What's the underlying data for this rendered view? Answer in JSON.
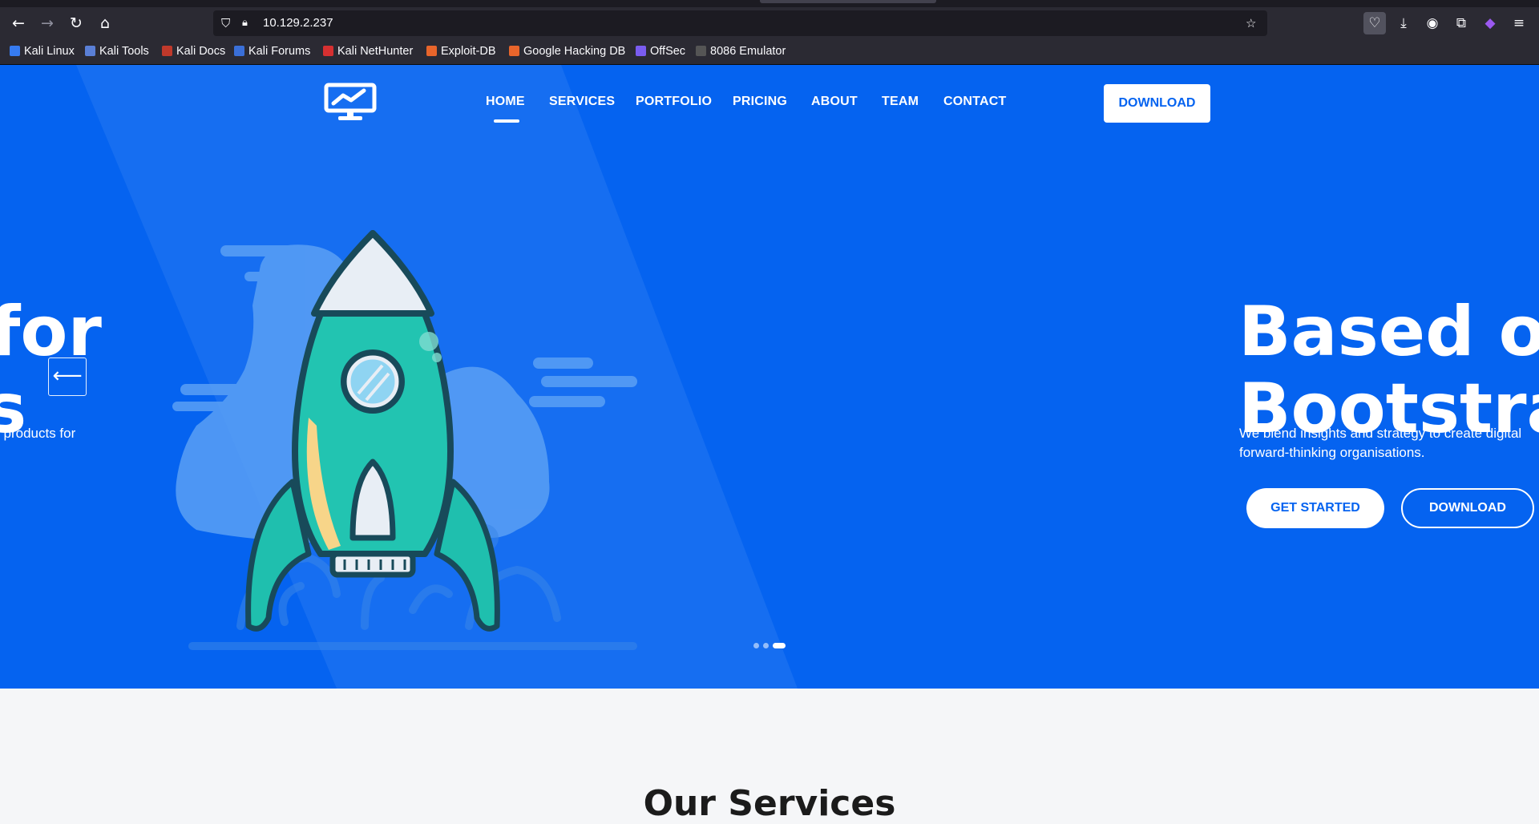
{
  "browser": {
    "url": "10.129.2.237",
    "bookmarks": [
      {
        "label": "Kali Linux",
        "color": "#367bf0"
      },
      {
        "label": "Kali Tools",
        "color": "#5a7fd6"
      },
      {
        "label": "Kali Docs",
        "color": "#c0392b"
      },
      {
        "label": "Kali Forums",
        "color": "#3a6fd8"
      },
      {
        "label": "Kali NetHunter",
        "color": "#d63031"
      },
      {
        "label": "Exploit-DB",
        "color": "#e8652b"
      },
      {
        "label": "Google Hacking DB",
        "color": "#e8652b"
      },
      {
        "label": "OffSec",
        "color": "#7a5cf0"
      },
      {
        "label": "8086 Emulator",
        "color": "#555555"
      }
    ]
  },
  "site": {
    "accent": "#0563f0",
    "nav": [
      "HOME",
      "SERVICES",
      "PORTFOLIO",
      "PRICING",
      "ABOUT",
      "TEAM",
      "CONTACT"
    ],
    "download_label": "DOWNLOAD",
    "slide_prev": {
      "line1": "for",
      "line2": "s",
      "text": "l products for"
    },
    "slide_current": {
      "line1": "Based on",
      "line2": "Bootstrap",
      "text_line1": "We blend insights and strategy to create digital",
      "text_line2": "forward-thinking organisations.",
      "get_started": "GET STARTED",
      "download": "DOWNLOAD"
    },
    "carousel_active_index": 2,
    "services_title": "Our Services"
  }
}
